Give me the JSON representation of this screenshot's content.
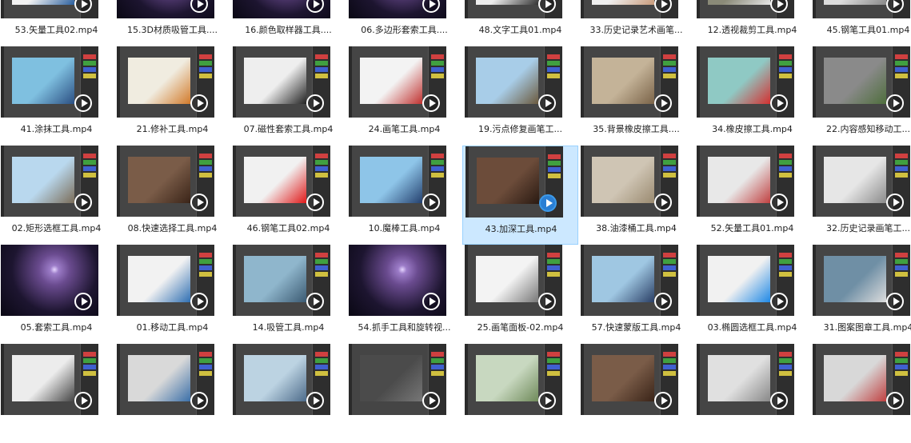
{
  "files": [
    {
      "label": "53.矢量工具02.mp4",
      "theme": "ps",
      "canvas": "#f2f2f2",
      "accent": "#2a5f9e"
    },
    {
      "label": "15.3D材质吸管工具....",
      "theme": "space",
      "canvas": "#1d1530",
      "accent": "#6a4b8f"
    },
    {
      "label": "16.颜色取样器工具....",
      "theme": "space",
      "canvas": "#1d1530",
      "accent": "#6a4b8f"
    },
    {
      "label": "06.多边形套索工具....",
      "theme": "space",
      "canvas": "#1d1530",
      "accent": "#6a4b8f"
    },
    {
      "label": "48.文字工具01.mp4",
      "theme": "ps",
      "canvas": "#ededed",
      "accent": "#333333"
    },
    {
      "label": "33.历史记录艺术画笔...",
      "theme": "ps",
      "canvas": "#efefef",
      "accent": "#c89a7a"
    },
    {
      "label": "12.透视裁剪工具.mp4",
      "theme": "ps",
      "canvas": "#8a8a78",
      "accent": "#e6e6e6"
    },
    {
      "label": "45.钢笔工具01.mp4",
      "theme": "ps",
      "canvas": "#dcdcdc",
      "accent": "#888888"
    },
    {
      "label": "41.涂抹工具.mp4",
      "theme": "ps",
      "canvas": "#7fc0e0",
      "accent": "#2b4f82"
    },
    {
      "label": "21.修补工具.mp4",
      "theme": "ps",
      "canvas": "#f0ece0",
      "accent": "#d27a2a"
    },
    {
      "label": "07.磁性套索工具.mp4",
      "theme": "ps",
      "canvas": "#eeeeee",
      "accent": "#222222"
    },
    {
      "label": "24.画笔工具.mp4",
      "theme": "ps",
      "canvas": "#f3f3f3",
      "accent": "#c0312f"
    },
    {
      "label": "19.污点修复画笔工...",
      "theme": "ps",
      "canvas": "#a8cde8",
      "accent": "#6b5a3e"
    },
    {
      "label": "35.背景橡皮擦工具....",
      "theme": "ps",
      "canvas": "#c4b398",
      "accent": "#7a6348"
    },
    {
      "label": "34.橡皮擦工具.mp4",
      "theme": "ps",
      "canvas": "#8fc9c4",
      "accent": "#d43030"
    },
    {
      "label": "22.内容感知移动工...",
      "theme": "ps",
      "canvas": "#8a8a8a",
      "accent": "#4e6e3c"
    },
    {
      "label": "02.矩形选框工具.mp4",
      "theme": "ps",
      "canvas": "#b9d8ee",
      "accent": "#7a6c58"
    },
    {
      "label": "08.快速选择工具.mp4",
      "theme": "ps",
      "canvas": "#7a5c48",
      "accent": "#3a2418"
    },
    {
      "label": "46.钢笔工具02.mp4",
      "theme": "ps",
      "canvas": "#f1f1f1",
      "accent": "#e01919"
    },
    {
      "label": "10.魔棒工具.mp4",
      "theme": "ps",
      "canvas": "#8ec5e8",
      "accent": "#24406e"
    },
    {
      "label": "43.加深工具.mp4",
      "theme": "ps",
      "canvas": "#6c4c3a",
      "accent": "#2a1a12"
    },
    {
      "label": "38.油漆桶工具.mp4",
      "theme": "ps",
      "canvas": "#cfc5b4",
      "accent": "#9a8a70"
    },
    {
      "label": "52.矢量工具01.mp4",
      "theme": "ps",
      "canvas": "#e8e8e8",
      "accent": "#c04040"
    },
    {
      "label": "32.历史记录画笔工...",
      "theme": "ps",
      "canvas": "#e6e6e6",
      "accent": "#8a8a8a"
    },
    {
      "label": "05.套索工具.mp4",
      "theme": "space",
      "canvas": "#1d1530",
      "accent": "#6a4b8f"
    },
    {
      "label": "01.移动工具.mp4",
      "theme": "ps",
      "canvas": "#f2f2f2",
      "accent": "#2f6fb2"
    },
    {
      "label": "14.吸管工具.mp4",
      "theme": "ps",
      "canvas": "#8fb6cc",
      "accent": "#3b5a72"
    },
    {
      "label": "54.抓手工具和旋转视...",
      "theme": "space",
      "canvas": "#1d1530",
      "accent": "#6a4b8f"
    },
    {
      "label": "25.画笔面板-02.mp4",
      "theme": "ps",
      "canvas": "#f3f3f3",
      "accent": "#777777"
    },
    {
      "label": "57.快速蒙版工具.mp4",
      "theme": "ps",
      "canvas": "#9fc7e2",
      "accent": "#2a3f66"
    },
    {
      "label": "03.椭圆选框工具.mp4",
      "theme": "ps",
      "canvas": "#f1f1f1",
      "accent": "#1e88e5"
    },
    {
      "label": "31.图案图章工具.mp4",
      "theme": "ps",
      "canvas": "#6f8fa5",
      "accent": "#dddddd"
    },
    {
      "label": "",
      "theme": "ps",
      "canvas": "#ececec",
      "accent": "#444444"
    },
    {
      "label": "",
      "theme": "ps",
      "canvas": "#d9d9d9",
      "accent": "#3b6fa8"
    },
    {
      "label": "",
      "theme": "ps",
      "canvas": "#bcd3e2",
      "accent": "#4d6b8a"
    },
    {
      "label": "",
      "theme": "ps",
      "canvas": "#4b4b4b",
      "accent": "#777777"
    },
    {
      "label": "",
      "theme": "ps",
      "canvas": "#c8d8c0",
      "accent": "#6f8a5a"
    },
    {
      "label": "",
      "theme": "ps",
      "canvas": "#7a5c48",
      "accent": "#3a2418"
    },
    {
      "label": "",
      "theme": "ps",
      "canvas": "#e0e0e0",
      "accent": "#888888"
    },
    {
      "label": "",
      "theme": "ps",
      "canvas": "#d8d8d8",
      "accent": "#c04040"
    }
  ],
  "selected_index": 20
}
